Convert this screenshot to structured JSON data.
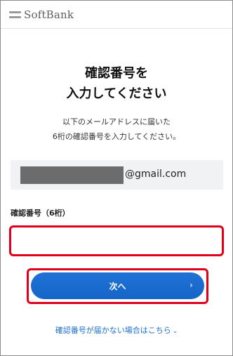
{
  "header": {
    "brand": "SoftBank"
  },
  "main": {
    "title_line1": "確認番号を",
    "title_line2": "入力してください",
    "desc_line1": "以下のメールアドレスに届いた",
    "desc_line2": "6桁の確認番号を入力してください。",
    "email_domain": "@gmail.com",
    "code_label": "確認番号（6桁）",
    "code_value": "",
    "next_label": "次へ",
    "help_link": "確認番号が届かない場合はこちら"
  },
  "colors": {
    "accent_blue": "#1f6fd0",
    "highlight_red": "#e0001b",
    "email_bg": "#f1f2f4"
  }
}
